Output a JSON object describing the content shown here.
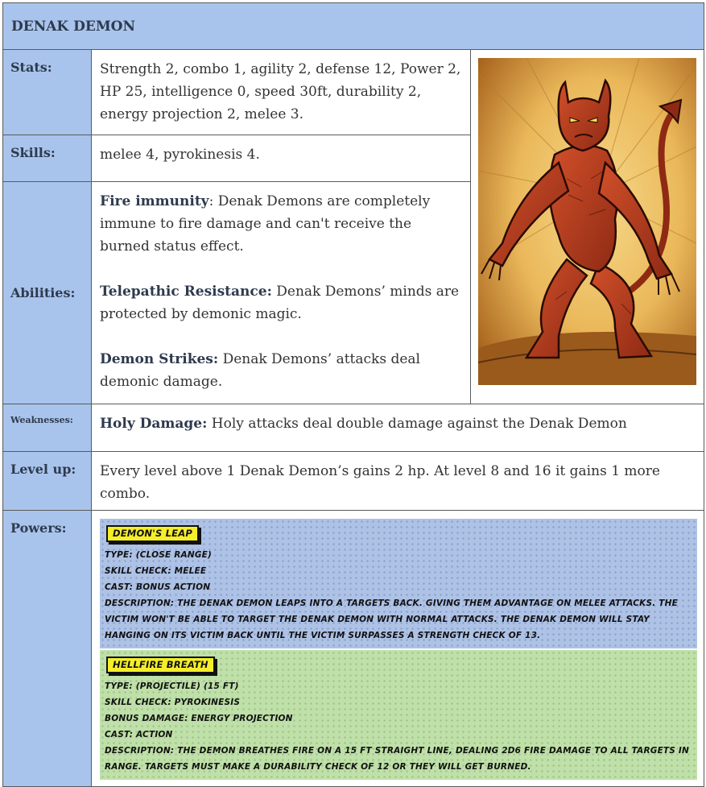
{
  "title": "DENAK DEMON",
  "stats": {
    "label": "Stats:",
    "text": "Strength 2, combo 1, agility 2, defense 12, Power 2, HP 25, intelligence 0, speed 30ft, durability 2, energy projection 2, melee 3."
  },
  "skills": {
    "label": "Skills:",
    "text": "melee 4, pyrokinesis 4."
  },
  "abilities": {
    "label": "Abilities:",
    "items": [
      {
        "name": "Fire immunity",
        "sep": ": ",
        "text": "Denak Demons are completely immune to fire damage and can't receive the burned status effect."
      },
      {
        "name": "Telepathic Resistance:",
        "sep": " ",
        "text": "Denak Demons’ minds are protected by demonic magic."
      },
      {
        "name": "Demon Strikes:",
        "sep": " ",
        "text": "Denak Demons’ attacks deal demonic damage."
      }
    ]
  },
  "weaknesses": {
    "label": "Weaknesses:",
    "name": "Holy Damage:",
    "text": " Holy attacks deal double damage against the Denak Demon"
  },
  "level_up": {
    "label": "Level up:",
    "text": "Every level above 1 Denak Demon’s gains 2 hp. At level 8 and 16 it gains 1 more combo."
  },
  "powers": {
    "label": "Powers:",
    "cards": [
      {
        "name": "Demon's Leap",
        "lines": [
          {
            "k": "Type:",
            "v": " (Close Range)"
          },
          {
            "k": "Skill Check:",
            "v": " Melee"
          },
          {
            "k": "Cast:",
            "v": " Bonus Action"
          },
          {
            "k": "Description:",
            "v": " The Denak Demon leaps into a targets back. Giving them advantage on melee attacks. The victim won't be able to target the denak demon with normal attacks. The Denak Demon will stay hanging on its victim back until the victim surpasses a Strength Check of 13."
          }
        ]
      },
      {
        "name": "Hellfire Breath",
        "lines": [
          {
            "k": "Type:",
            "v": " (Projectile) (15 ft)"
          },
          {
            "k": "Skill Check:",
            "v": " Pyrokinesis"
          },
          {
            "k": "Bonus Damage:",
            "v": " Energy Projection"
          },
          {
            "k": "Cast:",
            "v": " Action"
          },
          {
            "k": "Description:",
            "v": " The Demon breathes fire on a 15 ft straight line, dealing 2d6 Fire damage to all targets in range. Targets must make a durability check of 12 or they will get burned."
          }
        ]
      }
    ]
  },
  "image": {
    "icon": "demon-illustration"
  },
  "colors": {
    "header_blue": "#a9c4ec",
    "card_blue": "#aec2e6",
    "card_green": "#bfe0a8",
    "name_tag_yellow": "#f5ee2a"
  }
}
